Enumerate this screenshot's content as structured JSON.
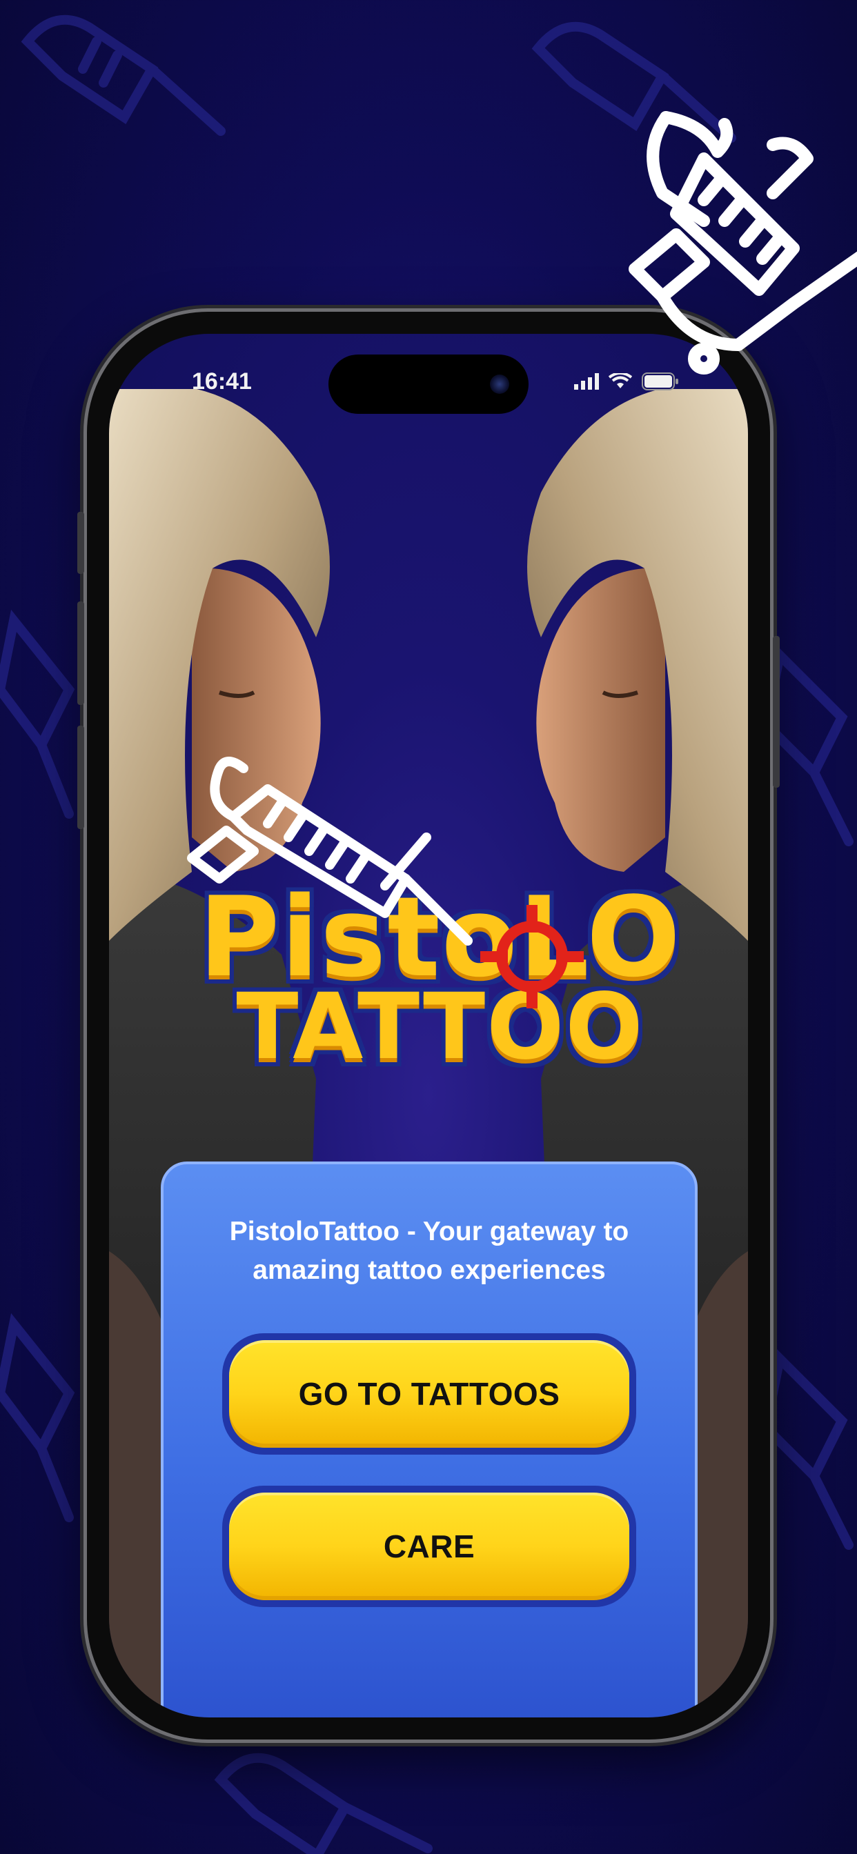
{
  "status_bar": {
    "time": "16:41"
  },
  "logo": {
    "line1": "PistoLO",
    "line2": "TATTOO"
  },
  "panel": {
    "tagline": "PistoloTattoo - Your gateway to amazing tattoo experiences",
    "go_to_tattoos_label": "GO TO TATTOOS",
    "care_label": "CARE"
  },
  "colors": {
    "background": "#0f0c55",
    "panel": "#3f6fe4",
    "button": "#ffd41a",
    "button_border": "#2136a8",
    "logo_fill": "#ffc61a",
    "logo_outline": "#1b2a8a"
  },
  "icons": [
    "tattoo-machine-icon",
    "crosshair-icon",
    "signal-icon",
    "wifi-icon",
    "battery-icon"
  ]
}
